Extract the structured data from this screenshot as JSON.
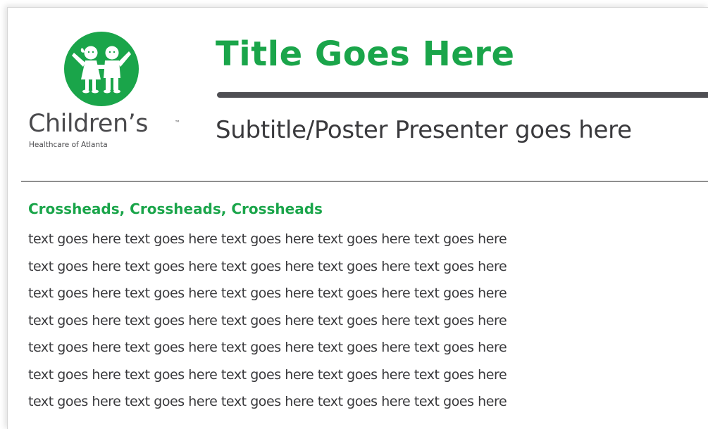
{
  "colors": {
    "brand_green": "#1aa54a",
    "rule_dark": "#4f4f53",
    "text_dark": "#3a3a3d"
  },
  "logo": {
    "icon": "children-holding-hands-icon",
    "wordmark": "Children’s",
    "trademark": "™",
    "tagline": "Healthcare of Atlanta"
  },
  "header": {
    "title": "Title Goes Here",
    "subtitle": "Subtitle/Poster Presenter goes here"
  },
  "section": {
    "crosshead": "Crossheads, Crossheads, Crossheads",
    "lines": [
      "text goes here text goes here text goes here text goes here text goes here",
      "text goes here text goes here text goes here text goes here text goes here",
      "text goes here text goes here text goes here text goes here text goes here",
      "text goes here text goes here text goes here text goes here text goes here",
      "text goes here text goes here text goes here text goes here text goes here",
      "text goes here text goes here text goes here text goes here text goes here",
      "text goes here text goes here text goes here text goes here text goes here"
    ]
  }
}
